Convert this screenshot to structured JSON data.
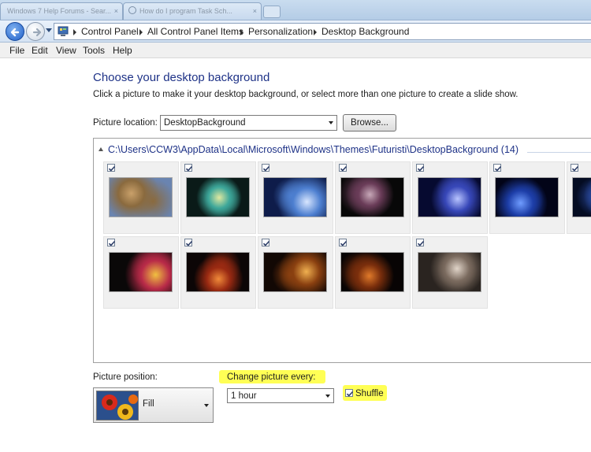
{
  "browser_tabs": [
    "Windows 7 Help Forums - Sear...",
    "How do I program Task Sch..."
  ],
  "breadcrumb": [
    "Control Panel",
    "All Control Panel Items",
    "Personalization",
    "Desktop Background"
  ],
  "menu": [
    "File",
    "Edit",
    "View",
    "Tools",
    "Help"
  ],
  "page": {
    "title": "Choose your desktop background",
    "subtitle": "Click a picture to make it your desktop background, or select more than one picture to create a slide show."
  },
  "picture_location": {
    "label": "Picture location:",
    "value": "DesktopBackground",
    "browse": "Browse..."
  },
  "folder": {
    "path": "C:\\Users\\CCW3\\AppData\\Local\\Microsoft\\Windows\\Themes\\Futuristi\\DesktopBackground (14)"
  },
  "thumbnails": [
    {
      "checked": true,
      "colors": [
        "#6a84b0",
        "#8a6a3e",
        "#c9a06a"
      ]
    },
    {
      "checked": true,
      "colors": [
        "#0a1a18",
        "#3da79a",
        "#e0e8a0"
      ]
    },
    {
      "checked": true,
      "colors": [
        "#0e1c4a",
        "#4d7fd0",
        "#d8e6ff"
      ]
    },
    {
      "checked": true,
      "colors": [
        "#080808",
        "#6a3c58",
        "#c7a8b8"
      ]
    },
    {
      "checked": true,
      "colors": [
        "#060a30",
        "#3747b8",
        "#b8c4ff"
      ]
    },
    {
      "checked": true,
      "colors": [
        "#020418",
        "#1d3ea8",
        "#6f9cff"
      ]
    },
    {
      "checked": true,
      "colors": [
        "#040c22",
        "#2a4aa0",
        "#7ab0ff"
      ]
    },
    {
      "checked": true,
      "colors": [
        "#0a0808",
        "#b82a48",
        "#f0c040"
      ]
    },
    {
      "checked": true,
      "colors": [
        "#0c0606",
        "#9a2a12",
        "#f08a3a"
      ]
    },
    {
      "checked": true,
      "colors": [
        "#120804",
        "#8a4010",
        "#f0b050"
      ]
    },
    {
      "checked": true,
      "colors": [
        "#080404",
        "#7a2e0c",
        "#e07a2a"
      ]
    },
    {
      "checked": true,
      "colors": [
        "#2a2420",
        "#7a6a5e",
        "#e0d4c8"
      ]
    }
  ],
  "picture_position": {
    "label": "Picture position:",
    "value": "Fill"
  },
  "change_picture": {
    "label": "Change picture every:",
    "value": "1 hour"
  },
  "shuffle": {
    "label": "Shuffle",
    "checked": true
  },
  "colors": {
    "title": "#1e3287",
    "highlight": "#ffff55"
  }
}
